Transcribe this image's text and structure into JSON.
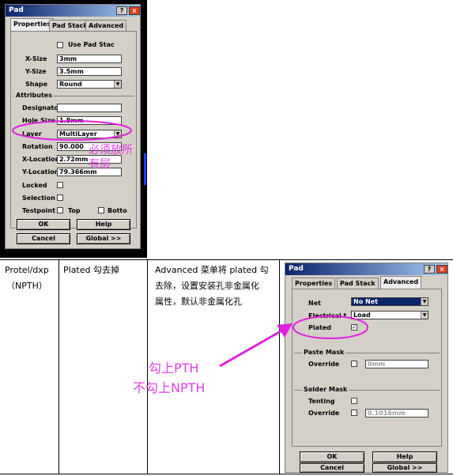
{
  "dialog1": {
    "title": "Pad",
    "help_glyph": "?",
    "close_glyph": "×",
    "tabs": [
      "Properties",
      "Pad Stack",
      "Advanced"
    ],
    "use_pad_stack": "Use Pad Stac",
    "xsize_label": "X-Size",
    "xsize": "3mm",
    "ysize_label": "Y-Size",
    "ysize": "3.5mm",
    "shape_label": "Shape",
    "shape": "Round",
    "attributes_label": "Attributes",
    "designator_label": "Designator",
    "designator": "",
    "holesize_label": "Hole Size",
    "holesize": "1.8mm",
    "layer_label": "Layer",
    "layer": "MultiLayer",
    "rotation_label": "Rotation",
    "rotation": "90.000",
    "xloc_label": "X-Location",
    "xloc": "2.72mm",
    "yloc_label": "Y-Location",
    "yloc": "79.366mm",
    "locked_label": "Locked",
    "selection_label": "Selection",
    "testpoint_label": "Testpoint",
    "top_label": "Top",
    "bottom_label": "Botto",
    "ok": "OK",
    "help": "Help",
    "cancel": "Cancel",
    "global": "Global >>",
    "annotation": "必须放所有层"
  },
  "table": {
    "col1": [
      "Protel/dxp",
      "（NPTH）"
    ],
    "col2": "Plated 勾去掉",
    "col3": [
      "Advanced 菜单将 plated 勾",
      "去除，设置安装孔非金属化",
      "属性，默认非金属化孔"
    ],
    "note1": "勾上PTH",
    "note2": "不勾上NPTH"
  },
  "dialog2": {
    "title": "Pad",
    "help_glyph": "?",
    "close_glyph": "×",
    "tabs": [
      "Properties",
      "Pad Stack",
      "Advanced"
    ],
    "net_label": "Net",
    "net": "No Net",
    "elec_label": "Electrical t",
    "elec": "Load",
    "plated_label": "Plated",
    "plated_mark": "✓",
    "paste_mask_label": "Paste Mask",
    "override_label": "Override",
    "paste_override": "0mm",
    "solder_mask_label": "Solder Mask",
    "tenting_label": "Tenting",
    "solder_override": "0.1016mm",
    "ok": "OK",
    "help": "Help",
    "cancel": "Cancel",
    "global": "Global >>"
  },
  "colors": {
    "annotation": "#e020e0",
    "selected_net": "#0a246a",
    "titlebar": "#0a246a"
  }
}
